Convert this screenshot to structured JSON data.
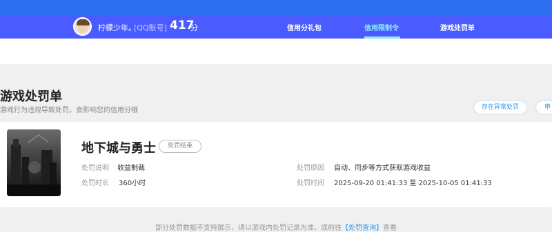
{
  "header": {
    "nickname": "柠檬少年。",
    "qq_tag": "[QQ账号]",
    "score": "417",
    "score_unit": "分",
    "nav": [
      {
        "label": "信用分礼包",
        "active": false
      },
      {
        "label": "信用限制令",
        "active": true
      },
      {
        "label": "游戏处罚单",
        "active": false
      }
    ],
    "accent_color": "#4a5cff",
    "active_color": "#8ee8ff"
  },
  "section": {
    "title": "游戏处罚单",
    "subtitle": "游戏行为违规导致处罚，会影响您的信用分哦",
    "appeal_button": "存在异常处罚",
    "partial_button": "申"
  },
  "penalty": {
    "game_name": "地下城与勇士",
    "status": "处罚结束",
    "labels": {
      "method": "处罚说明",
      "reason": "处罚原因",
      "duration": "处罚时长",
      "time": "处罚时间"
    },
    "method_value": "收益制裁",
    "reason_value": "自动、同步等方式获取游戏收益",
    "duration_value": "360小时",
    "time_value": "2025-09-20 01:41:33 至 2025-10-05 01:41:33"
  },
  "footer": {
    "note_prefix": "部分处罚数据不支持展示，请以游戏内处罚记录为准，或前往",
    "note_link": "【处罚查询】",
    "note_suffix": "查看"
  }
}
